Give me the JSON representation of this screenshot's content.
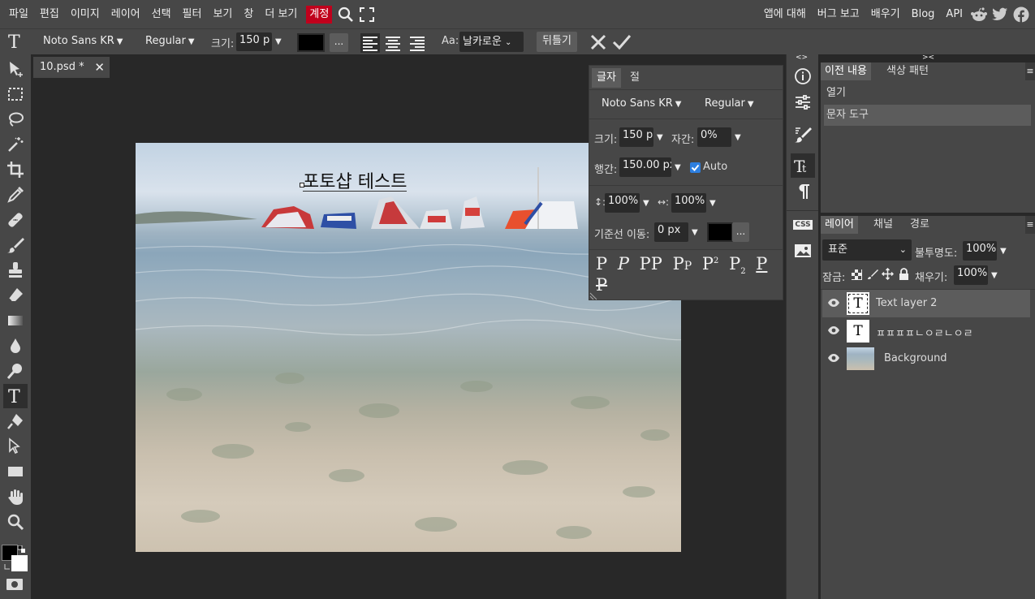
{
  "menu": {
    "items": [
      "파일",
      "편집",
      "이미지",
      "레이어",
      "선택",
      "필터",
      "보기",
      "창",
      "더 보기"
    ],
    "account": "계정",
    "right_items": [
      "앱에 대해",
      "버그 보고",
      "배우기",
      "Blog",
      "API"
    ]
  },
  "options": {
    "font_family": "Noto Sans KR",
    "font_style": "Regular",
    "size_label": "크기:",
    "size_value": "150 p",
    "more": "...",
    "aa_label": "Aa:",
    "aa_value": "날카로운",
    "warp_button": "뒤틀기",
    "text_color": "#000000"
  },
  "document": {
    "tab_title": "10.psd *",
    "text_layer_content": "포토샵 테스트"
  },
  "character_panel": {
    "tabs": [
      "글자",
      "절"
    ],
    "font_family": "Noto Sans KR",
    "font_style": "Regular",
    "size_label": "크기:",
    "size_value": "150 p:",
    "tracking_label": "자간:",
    "tracking_value": "0%",
    "leading_label": "행간:",
    "leading_value": "150.00 px",
    "leading_auto": "Auto",
    "vscale_value": "100%",
    "hscale_value": "100%",
    "baseline_label": "기준선 이동:",
    "baseline_value": "0 px",
    "more": "...",
    "color": "#000000"
  },
  "history_panel": {
    "tabs": [
      "이전 내용",
      "색상 패턴"
    ],
    "items": [
      "열기",
      "문자 도구"
    ]
  },
  "layers_panel": {
    "tabs": [
      "레이어",
      "채널",
      "경로"
    ],
    "blend_mode": "표준",
    "opacity_label": "불투명도:",
    "opacity_value": "100%",
    "lock_label": "잠금:",
    "fill_label": "채우기:",
    "fill_value": "100%",
    "layers": [
      {
        "name": "Text layer 2",
        "type": "text"
      },
      {
        "name": "ㅍㅍㅍㅍㄴㅇㄹㄴㅇㄹ",
        "type": "text"
      },
      {
        "name": "Background",
        "type": "image"
      }
    ]
  },
  "side_icons": {
    "css_label": "CSS"
  }
}
